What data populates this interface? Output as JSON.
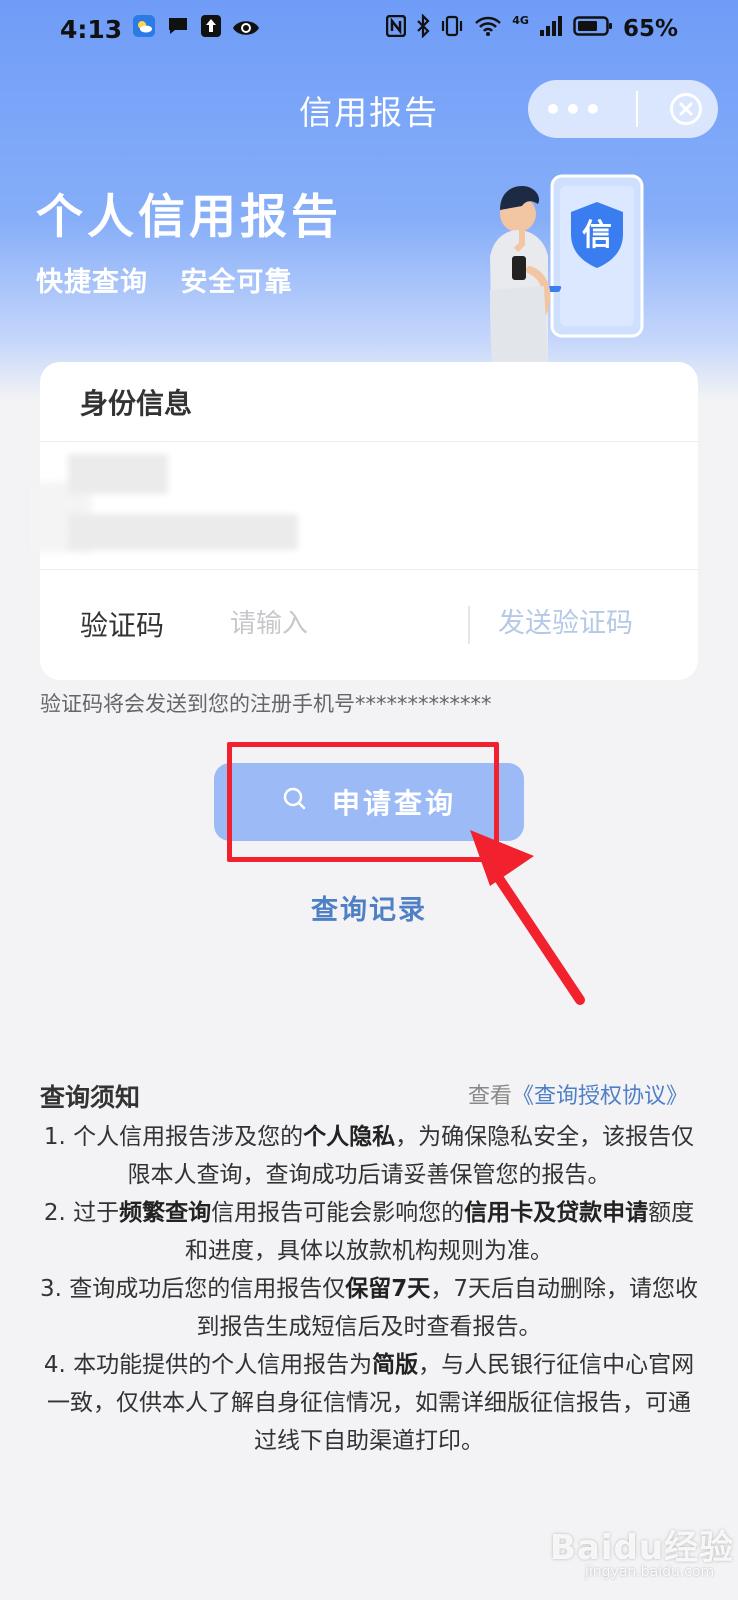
{
  "status_bar": {
    "time": "4:13",
    "network": "4G",
    "battery": "65%",
    "icons": [
      "weather-icon",
      "message-icon",
      "upload-icon",
      "eye-icon",
      "nfc-icon",
      "bluetooth-icon",
      "vibrate-icon",
      "wifi-icon",
      "signal-icon",
      "battery-icon"
    ]
  },
  "nav": {
    "title": "信用报告",
    "more_label": "•••"
  },
  "hero": {
    "title": "个人信用报告",
    "tags": [
      "快捷查询",
      "安全可靠"
    ],
    "shield_char": "信"
  },
  "form": {
    "section_title": "身份信息",
    "code_label": "验证码",
    "code_placeholder": "请输入",
    "send_code_label": "发送验证码",
    "hint": "验证码将会发送到您的注册手机号*************"
  },
  "actions": {
    "apply_label": "申请查询",
    "records_label": "查询记录"
  },
  "notice": {
    "title": "查询须知",
    "view_prefix": "查看",
    "agreement_link": "《查询授权协议》",
    "items": [
      {
        "a": "1. 个人信用报告涉及您的",
        "b": "个人隐私",
        "c": "，为确保隐私安全，该报告仅限本人查询，查询成功后请妥善保管您的报告。"
      },
      {
        "a": "2. 过于",
        "b": "频繁查询",
        "c": "信用报告可能会影响您的",
        "d": "信用卡及贷款申请",
        "e": "额度和进度，具体以放款机构规则为准。"
      },
      {
        "a": "3. 查询成功后您的信用报告仅",
        "b": "保留7天",
        "c": "，7天后自动删除，请您收到报告生成短信后及时查看报告。"
      },
      {
        "a": "4. 本功能提供的个人信用报告为",
        "b": "简版",
        "c": "，与人民银行征信中心官网一致，仅供本人了解自身征信情况，如需详细版征信报告，可通过线下自助渠道打印。"
      }
    ]
  },
  "watermark": {
    "brand": "Baidu经验",
    "url": "jingyan.baidu.com"
  },
  "colors": {
    "hero_blue": "#6f9cf7",
    "button_blue": "#9bbaf6",
    "link_blue": "#4f80c6",
    "highlight_red": "#f1212d"
  }
}
